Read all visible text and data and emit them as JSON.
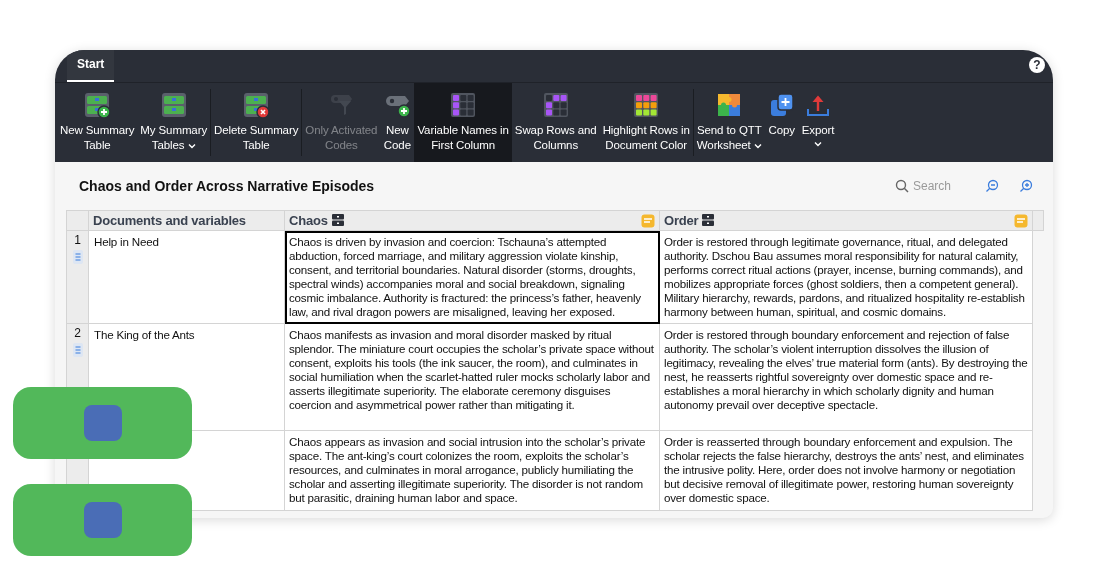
{
  "tabs": [
    {
      "label": "Start",
      "selected": true
    }
  ],
  "help": "?",
  "toolbar": [
    {
      "kind": "button",
      "label": "New Summary\nTable",
      "disabled": false,
      "selected": false,
      "dropdown": false
    },
    {
      "kind": "button",
      "label": "My Summary\nTables",
      "disabled": false,
      "selected": false,
      "dropdown": true
    },
    {
      "kind": "separator"
    },
    {
      "kind": "button",
      "label": "Delete Summary\nTable",
      "disabled": false,
      "selected": false,
      "dropdown": false
    },
    {
      "kind": "separator"
    },
    {
      "kind": "button",
      "label": "Only Activated\nCodes",
      "disabled": true,
      "selected": false,
      "dropdown": false
    },
    {
      "kind": "button",
      "label": "New\nCode",
      "disabled": false,
      "selected": false,
      "dropdown": false
    },
    {
      "kind": "button",
      "label": "Variable Names in\nFirst Column",
      "disabled": false,
      "selected": true,
      "dropdown": false
    },
    {
      "kind": "button",
      "label": "Swap Rows and\nColumns",
      "disabled": false,
      "selected": false,
      "dropdown": false
    },
    {
      "kind": "button",
      "label": "Highlight Rows in\nDocument Color",
      "disabled": false,
      "selected": false,
      "dropdown": false
    },
    {
      "kind": "separator"
    },
    {
      "kind": "button",
      "label": "Send to QTT\nWorksheet",
      "disabled": false,
      "selected": false,
      "dropdown": true
    },
    {
      "kind": "button",
      "label": "Copy",
      "disabled": false,
      "selected": false,
      "dropdown": false
    },
    {
      "kind": "button",
      "label": "Export",
      "disabled": false,
      "selected": false,
      "dropdown": true
    }
  ],
  "title": "Chaos and Order Across Narrative Episodes",
  "search": {
    "placeholder": "Search"
  },
  "table": {
    "document_column": "Documents and variables",
    "columns": [
      "Chaos",
      "Order"
    ],
    "rows": [
      {
        "number": "1",
        "document": "Help in Need",
        "cells": [
          {
            "text": "Chaos is driven by invasion and coercion: Tschauna’s attempted abduction, forced marriage, and military aggression violate kinship, consent, and territorial boundaries. Natural disorder (storms, droughts, spectral winds) accompanies moral and social breakdown, signaling cosmic imbalance. Authority is fractured: the princess’s father, heavenly law, and rival dragon powers are misaligned, leaving her exposed.",
            "selected": true
          },
          {
            "text": "Order is restored through legitimate governance, ritual, and delegated authority. Dschou Bau assumes moral responsibility for natural calamity, performs correct ritual actions (prayer, incense, burning commands), and mobilizes appropriate forces (ghost soldiers, then a competent general). Military hierarchy, rewards, pardons, and ritualized hospitality re-establish harmony between human, spiritual, and cosmic domains.",
            "selected": false
          }
        ]
      },
      {
        "number": "2",
        "document": "The King of the Ants",
        "cells": [
          {
            "text": "Chaos manifests as invasion and moral disorder masked by ritual splendor. The miniature court occupies the scholar’s private space without consent, exploits his tools (the ink saucer, the room), and culminates in social humiliation when the scarlet-hatted ruler mocks scholarly labor and asserts illegitimate superiority. The elaborate ceremony disguises coercion and asymmetrical power rather than mitigating it.",
            "selected": false
          },
          {
            "text": "Order is restored through boundary enforcement and rejection of false authority. The scholar’s violent interruption dissolves the illusion of legitimacy, revealing the elves’ true material form (ants). By destroying the nest, he reasserts rightful sovereignty over domestic space and re-establishes a moral hierarchy in which scholarly dignity and human autonomy prevail over deceptive spectacle.",
            "selected": false
          }
        ]
      },
      {
        "cells": [
          {
            "text": "Chaos appears as invasion and social intrusion into the scholar’s private space. The ant-king’s court colonizes the room, exploits the scholar’s resources, and culminates in moral arrogance, publicly humiliating the scholar and asserting illegitimate superiority. The disorder is not random but parasitic, draining human labor and space.",
            "selected": false
          },
          {
            "text": "Order is reasserted through boundary enforcement and expulsion. The scholar rejects the false hierarchy, destroys the ants’ nest, and eliminates the intrusive polity. Here, order does not involve harmony or negotiation but decisive removal of illegitimate power, restoring human sovereignty over domestic space.",
            "selected": false
          }
        ]
      }
    ]
  }
}
